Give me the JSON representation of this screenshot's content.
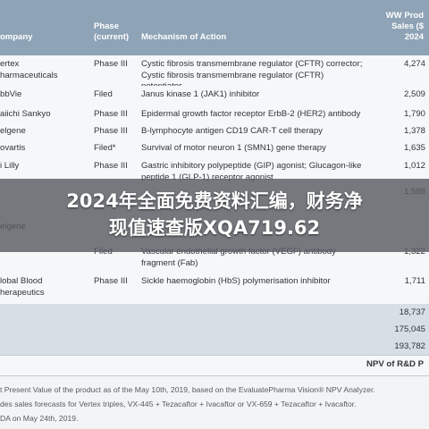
{
  "header": {
    "company": "ompany",
    "phase_line1": "Phase",
    "phase_line2": "(current)",
    "moa": "Mechanism of Action",
    "ww_line1": "WW Prod",
    "ww_line2": "Sales ($",
    "ww_line3": "2024"
  },
  "rows": [
    {
      "company": [
        "ertex",
        "harmaceuticals"
      ],
      "phase": "Phase III",
      "moa": [
        "Cystic fibrosis transmembrane regulator (CFTR) corrector;",
        "Cystic fibrosis transmembrane regulator (CFTR)",
        "potentiator"
      ],
      "value": "4,274"
    },
    {
      "company": [
        "bbVie"
      ],
      "phase": "Filed",
      "moa": [
        "Janus kinase 1 (JAK1) inhibitor"
      ],
      "value": "2,509"
    },
    {
      "company": [
        "aiichi Sankyo"
      ],
      "phase": "Phase III",
      "moa": [
        "Epidermal growth factor receptor ErbB-2 (HER2) antibody"
      ],
      "value": "1,790"
    },
    {
      "company": [
        "elgene"
      ],
      "phase": "Phase III",
      "moa": [
        "B-lymphocyte antigen CD19 CAR-T cell therapy"
      ],
      "value": "1,378"
    },
    {
      "company": [
        "ovartis"
      ],
      "phase": "Filed*",
      "moa": [
        "Survival of motor neuron 1 (SMN1) gene therapy"
      ],
      "value": "1,635"
    },
    {
      "company": [
        "i Lilly"
      ],
      "phase": "Phase III",
      "moa": [
        "Gastric inhibitory polypeptide (GIP) agonist; Glucagon-like",
        "peptide 1 (GLP-1) receptor agonist"
      ],
      "value": "1,012"
    },
    {
      "company": [
        ""
      ],
      "phase": "",
      "moa": [
        ""
      ],
      "value": "1,589"
    },
    {
      "company": [
        "elgene"
      ],
      "phase": "",
      "moa": [
        ""
      ],
      "value": ""
    },
    {
      "company": [
        ""
      ],
      "phase": "Filed",
      "moa": [
        "Vascular endothelial growth factor (VEGF) antibody",
        "fragment (Fab)"
      ],
      "value": "1,322"
    },
    {
      "company": [
        "lobal Blood",
        "herapeutics"
      ],
      "phase": "Phase III",
      "moa": [
        "Sickle haemoglobin (HbS) polymerisation inhibitor"
      ],
      "value": "1,711"
    }
  ],
  "summary": [
    "18,737",
    "175,045",
    "193,782"
  ],
  "npv_label": "NPV of R&D P",
  "footnotes": [
    "t Present Value of the product as of the May 10th, 2019, based on the EvaluatePharma Vision® NPV Analyzer.",
    "des sales forecasts for Vertex triples, VX-445 + Tezacaftor + Ivacaftor or VX-659 + Tezacaftor + Ivacaftor.",
    "DA on May 24th, 2019."
  ],
  "banner": {
    "line1": "2024年全面免费资料汇编，财务净",
    "line2": "现值速查版XQA719.62"
  }
}
